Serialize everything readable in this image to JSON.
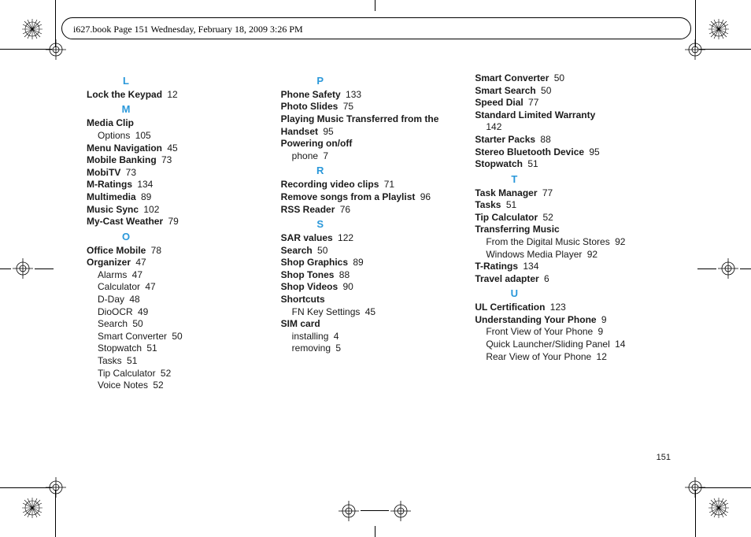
{
  "header": "i627.book  Page 151  Wednesday, February 18, 2009  3:26 PM",
  "pageNumber": "151",
  "columns": [
    [
      {
        "type": "letter",
        "text": "L"
      },
      {
        "type": "entry",
        "term": "Lock the Keypad",
        "page": "12"
      },
      {
        "type": "letter",
        "text": "M"
      },
      {
        "type": "entry",
        "term": "Media Clip"
      },
      {
        "type": "sub",
        "term": "Options",
        "page": "105"
      },
      {
        "type": "entry",
        "term": "Menu Navigation",
        "page": "45"
      },
      {
        "type": "entry",
        "term": "Mobile Banking",
        "page": "73"
      },
      {
        "type": "entry",
        "term": "MobiTV",
        "page": "73"
      },
      {
        "type": "entry",
        "term": "M-Ratings",
        "page": "134"
      },
      {
        "type": "entry",
        "term": "Multimedia",
        "page": "89"
      },
      {
        "type": "entry",
        "term": "Music Sync",
        "page": "102"
      },
      {
        "type": "entry",
        "term": "My-Cast Weather",
        "page": "79"
      },
      {
        "type": "letter",
        "text": "O"
      },
      {
        "type": "entry",
        "term": "Office Mobile",
        "page": "78"
      },
      {
        "type": "entry",
        "term": "Organizer",
        "page": "47"
      },
      {
        "type": "sub",
        "term": "Alarms",
        "page": "47"
      },
      {
        "type": "sub",
        "term": "Calculator",
        "page": "47"
      },
      {
        "type": "sub",
        "term": "D-Day",
        "page": "48"
      },
      {
        "type": "sub",
        "term": "DioOCR",
        "page": "49"
      },
      {
        "type": "sub",
        "term": "Search",
        "page": "50"
      },
      {
        "type": "sub",
        "term": "Smart Converter",
        "page": "50"
      },
      {
        "type": "sub",
        "term": "Stopwatch",
        "page": "51"
      },
      {
        "type": "sub",
        "term": "Tasks",
        "page": "51"
      },
      {
        "type": "sub",
        "term": "Tip Calculator",
        "page": "52"
      },
      {
        "type": "sub",
        "term": "Voice Notes",
        "page": "52"
      }
    ],
    [
      {
        "type": "letter",
        "text": "P"
      },
      {
        "type": "entry",
        "term": "Phone Safety",
        "page": "133"
      },
      {
        "type": "entry",
        "term": "Photo Slides",
        "page": "75"
      },
      {
        "type": "entry",
        "term": "Playing Music Transferred from the Handset",
        "page": "95"
      },
      {
        "type": "entry",
        "term": "Powering on/off"
      },
      {
        "type": "sub",
        "term": "phone",
        "page": "7"
      },
      {
        "type": "letter",
        "text": "R"
      },
      {
        "type": "entry",
        "term": "Recording video clips",
        "page": "71"
      },
      {
        "type": "entry",
        "term": "Remove songs from a Playlist",
        "page": "96"
      },
      {
        "type": "entry",
        "term": "RSS Reader",
        "page": "76"
      },
      {
        "type": "letter",
        "text": "S"
      },
      {
        "type": "entry",
        "term": "SAR values",
        "page": "122"
      },
      {
        "type": "entry",
        "term": "Search",
        "page": "50"
      },
      {
        "type": "entry",
        "term": "Shop Graphics",
        "page": "89"
      },
      {
        "type": "entry",
        "term": "Shop Tones",
        "page": "88"
      },
      {
        "type": "entry",
        "term": "Shop Videos",
        "page": "90"
      },
      {
        "type": "entry",
        "term": "Shortcuts"
      },
      {
        "type": "sub",
        "term": "FN Key Settings",
        "page": "45"
      },
      {
        "type": "entry",
        "term": "SIM card"
      },
      {
        "type": "sub",
        "term": "installing",
        "page": "4"
      },
      {
        "type": "sub",
        "term": "removing",
        "page": "5"
      }
    ],
    [
      {
        "type": "entry",
        "term": "Smart Converter",
        "page": "50"
      },
      {
        "type": "entry",
        "term": "Smart Search",
        "page": "50"
      },
      {
        "type": "entry",
        "term": "Speed Dial",
        "page": "77"
      },
      {
        "type": "entry",
        "term": "Standard Limited Warranty"
      },
      {
        "type": "subpage",
        "page": "142"
      },
      {
        "type": "entry",
        "term": "Starter Packs",
        "page": "88"
      },
      {
        "type": "entry",
        "term": "Stereo Bluetooth Device",
        "page": "95"
      },
      {
        "type": "entry",
        "term": "Stopwatch",
        "page": "51"
      },
      {
        "type": "letter",
        "text": "T"
      },
      {
        "type": "entry",
        "term": "Task Manager",
        "page": "77"
      },
      {
        "type": "entry",
        "term": "Tasks",
        "page": "51"
      },
      {
        "type": "entry",
        "term": "Tip Calculator",
        "page": "52"
      },
      {
        "type": "entry",
        "term": "Transferring Music"
      },
      {
        "type": "sub",
        "term": "From the Digital Music Stores",
        "page": "92"
      },
      {
        "type": "sub",
        "term": "Windows Media Player",
        "page": "92"
      },
      {
        "type": "entry",
        "term": "T-Ratings",
        "page": "134"
      },
      {
        "type": "entry",
        "term": "Travel adapter",
        "page": "6"
      },
      {
        "type": "letter",
        "text": "U"
      },
      {
        "type": "entry",
        "term": "UL Certification",
        "page": "123"
      },
      {
        "type": "entry",
        "term": "Understanding Your Phone",
        "page": "9"
      },
      {
        "type": "sub",
        "term": "Front View of Your Phone",
        "page": "9"
      },
      {
        "type": "sub",
        "term": "Quick Launcher/Sliding Panel",
        "page": "14"
      },
      {
        "type": "sub",
        "term": "Rear View of Your Phone",
        "page": "12"
      }
    ]
  ]
}
